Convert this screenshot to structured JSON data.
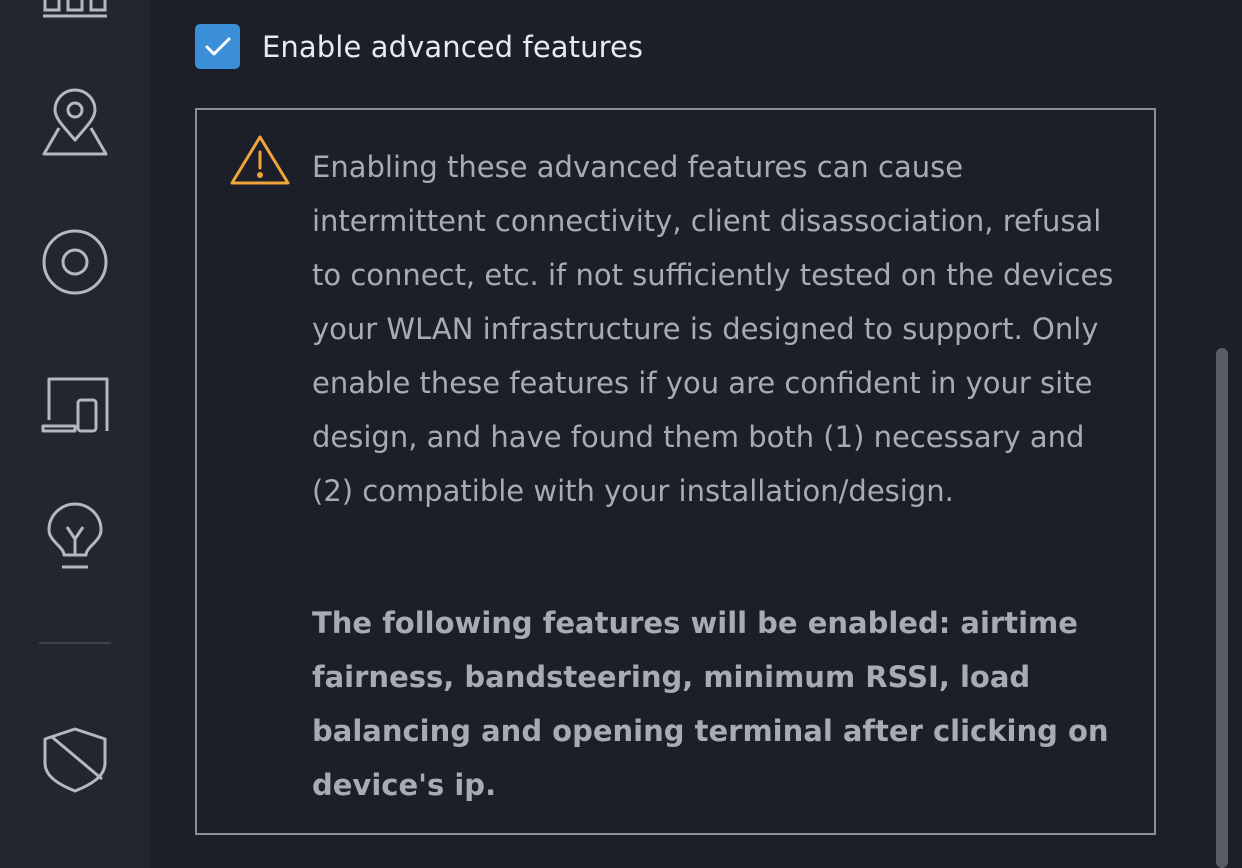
{
  "sidebar": {
    "items": [
      {
        "icon": "bar-chart-icon"
      },
      {
        "icon": "map-pin-icon"
      },
      {
        "icon": "target-circle-icon"
      },
      {
        "icon": "devices-icon"
      },
      {
        "icon": "lightbulb-icon"
      },
      {
        "icon": "shield-icon"
      }
    ]
  },
  "settings": {
    "checkbox_label": "Enable advanced features",
    "checked": true
  },
  "warning": {
    "icon": "warning-triangle-icon",
    "message": "Enabling these advanced features can cause intermittent connectivity, client disassociation, refusal to connect, etc. if not sufficiently tested on the devices your WLAN infrastructure is designed to support. Only enable these features if you are confident in your site design, and have found them both (1) necessary and (2) compatible with your installation/design.",
    "features_note": "The following features will be enabled: airtime fairness, bandsteering, minimum RSSI, load balancing and opening terminal after clicking on device's ip."
  },
  "colors": {
    "accent": "#3a8fd8",
    "warning": "#f0a53a",
    "background": "#1c1e2a",
    "sidebar": "#23252f"
  }
}
